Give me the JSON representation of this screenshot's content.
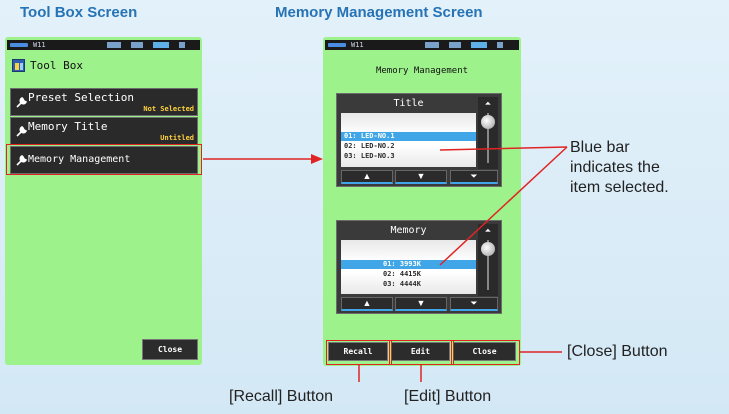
{
  "captions": {
    "tool_box": "Tool Box Screen",
    "memory_management": "Memory Management Screen"
  },
  "status_bar": {
    "mode": "W11"
  },
  "tool_box_screen": {
    "title": "Tool Box",
    "items": [
      {
        "label": "Preset Selection",
        "sub": "Not Selected"
      },
      {
        "label": "Memory Title",
        "sub": "Untitled"
      },
      {
        "label": "Memory Management",
        "sub": ""
      }
    ],
    "close_label": "Close"
  },
  "memory_screen": {
    "title": "Memory Management",
    "title_panel": {
      "heading": "Title",
      "rows": [
        "01: LED-NO.1",
        "02: LED-NO.2",
        "03: LED-NO.3"
      ],
      "selected_index": 0
    },
    "memory_panel": {
      "heading": "Memory",
      "rows": [
        "01:  3993K",
        "02:  4415K",
        "03:  4444K"
      ],
      "selected_index": 0
    },
    "buttons": {
      "recall": "Recall",
      "edit": "Edit",
      "close": "Close"
    }
  },
  "annotations": {
    "blue_bar": "Blue bar\nindicates the\nitem selected.",
    "close_button": "[Close] Button",
    "recall_button": "[Recall] Button",
    "edit_button": "[Edit] Button"
  },
  "colors": {
    "screen_bg": "#9ef28c",
    "caption": "#2673b5",
    "highlight": "#e02424",
    "selection": "#41a6e8"
  }
}
